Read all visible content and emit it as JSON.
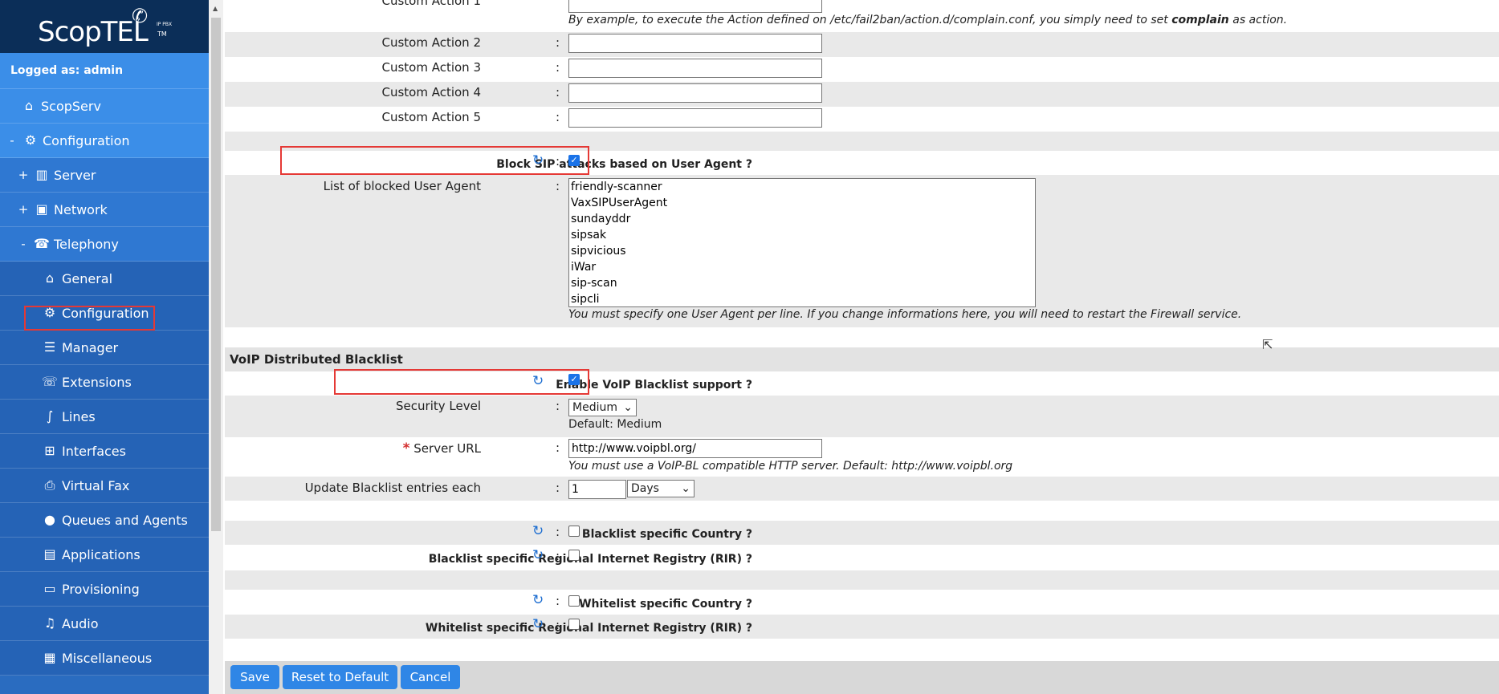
{
  "sidebar": {
    "brand": "ScopTEL",
    "brand_sub": "IP PBX",
    "brand_tm": "TM",
    "logged_as": "Logged as: admin",
    "items": [
      {
        "label": "ScopServ"
      },
      {
        "toggle": "-",
        "label": "Configuration"
      },
      {
        "toggle": "+",
        "label": "Server"
      },
      {
        "toggle": "+",
        "label": "Network"
      },
      {
        "toggle": "-",
        "label": "Telephony"
      },
      {
        "label": "General"
      },
      {
        "label": "Configuration"
      },
      {
        "label": "Manager"
      },
      {
        "label": "Extensions"
      },
      {
        "label": "Lines"
      },
      {
        "label": "Interfaces"
      },
      {
        "label": "Virtual Fax"
      },
      {
        "label": "Queues and Agents"
      },
      {
        "label": "Applications"
      },
      {
        "label": "Provisioning"
      },
      {
        "label": "Audio"
      },
      {
        "label": "Miscellaneous"
      }
    ]
  },
  "form": {
    "custom_action_1": {
      "label": "Custom Action 1",
      "value": ""
    },
    "custom_action_help": "By example, to execute the Action defined on /etc/fail2ban/action.d/complain.conf, you simply need to set",
    "custom_action_help_bold": "complain",
    "custom_action_help_tail": "as action.",
    "custom_action_2": {
      "label": "Custom Action 2",
      "value": ""
    },
    "custom_action_3": {
      "label": "Custom Action 3",
      "value": ""
    },
    "custom_action_4": {
      "label": "Custom Action 4",
      "value": ""
    },
    "custom_action_5": {
      "label": "Custom Action 5",
      "value": ""
    },
    "block_sip": {
      "label": "Block SIP attacks based on User Agent ?",
      "checked": true
    },
    "blocked_ua": {
      "label": "List of blocked User Agent",
      "value": "friendly-scanner\nVaxSIPUserAgent\nsundayddr\nsipsak\nsipvicious\niWar\nsip-scan\nsipcli",
      "help": "You must specify one User Agent per line. If you change informations here, you will need to restart the Firewall service."
    },
    "voip_section_title": "VoIP Distributed Blacklist",
    "enable_voip_bl": {
      "label": "Enable VoIP Blacklist support ?",
      "checked": true
    },
    "security_level": {
      "label": "Security Level",
      "value": "Medium",
      "help": "Default: Medium"
    },
    "server_url": {
      "required_mark": "*",
      "label": "Server URL",
      "value": "http://www.voipbl.org/",
      "help": "You must use a VoIP-BL compatible HTTP server. Default: http://www.voipbl.org"
    },
    "update_each": {
      "label": "Update Blacklist entries each",
      "value": "1",
      "unit": "Days"
    },
    "bl_country": {
      "label": "Blacklist specific Country ?",
      "checked": false
    },
    "bl_rir": {
      "label": "Blacklist specific Regional Internet Registry (RIR) ?",
      "checked": false
    },
    "wl_country": {
      "label": "Whitelist specific Country ?",
      "checked": false
    },
    "wl_rir": {
      "label": "Whitelist specific Regional Internet Registry (RIR) ?",
      "checked": false
    },
    "colon": ":"
  },
  "buttons": {
    "save": "Save",
    "reset": "Reset to Default",
    "cancel": "Cancel"
  },
  "colors": {
    "sidebar_bg": "#2a6cc0",
    "logo_bg": "#0b2e58",
    "highlight": "#e53935",
    "button": "#2f86e6"
  },
  "icons": {
    "refresh": "refresh-icon",
    "checkbox_checked": "check-icon"
  }
}
